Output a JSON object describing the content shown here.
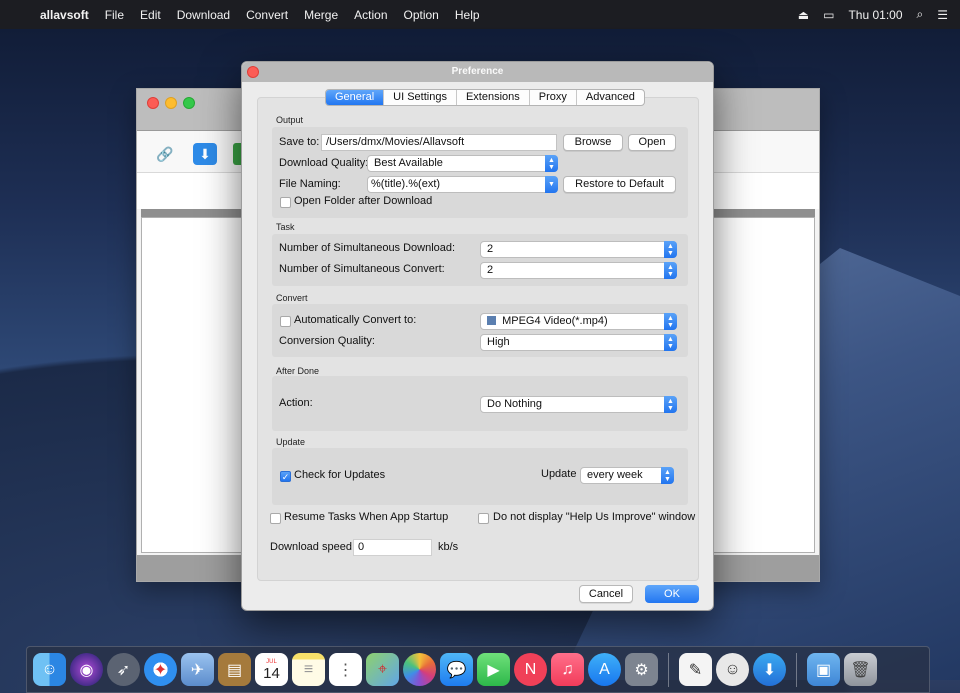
{
  "menubar": {
    "app_name": "allavsoft",
    "items": [
      "File",
      "Edit",
      "Download",
      "Convert",
      "Merge",
      "Action",
      "Option",
      "Help"
    ],
    "clock": "Thu 01:00"
  },
  "dialog": {
    "title": "Preference",
    "tabs": [
      {
        "label": "General",
        "active": true
      },
      {
        "label": "UI Settings",
        "active": false
      },
      {
        "label": "Extensions",
        "active": false
      },
      {
        "label": "Proxy",
        "active": false
      },
      {
        "label": "Advanced",
        "active": false
      }
    ],
    "output": {
      "section_label": "Output",
      "save_to_label": "Save to:",
      "save_to_value": "/Users/dmx/Movies/Allavsoft",
      "browse_label": "Browse",
      "open_label": "Open",
      "quality_label": "Download Quality:",
      "quality_value": "Best Available",
      "naming_label": "File Naming:",
      "naming_value": "%(title).%(ext)",
      "restore_label": "Restore to Default",
      "open_folder_label": "Open Folder after Download",
      "open_folder_checked": false
    },
    "task": {
      "section_label": "Task",
      "sim_download_label": "Number of Simultaneous Download:",
      "sim_download_value": "2",
      "sim_convert_label": "Number of Simultaneous Convert:",
      "sim_convert_value": "2"
    },
    "convert": {
      "section_label": "Convert",
      "auto_convert_label": "Automatically Convert to:",
      "auto_convert_checked": false,
      "format_value": "MPEG4 Video(*.mp4)",
      "quality_label": "Conversion Quality:",
      "quality_value": "High"
    },
    "after_done": {
      "section_label": "After Done",
      "action_label": "Action:",
      "action_value": "Do Nothing"
    },
    "update": {
      "section_label": "Update",
      "check_label": "Check for Updates",
      "check_checked": true,
      "update_label": "Update",
      "update_value": "every week"
    },
    "resume_label": "Resume Tasks When App Startup",
    "no_help_label": "Do not display \"Help Us Improve\" window",
    "speed_label": "Download speed:",
    "speed_value": "0",
    "speed_unit": "kb/s",
    "cancel_label": "Cancel",
    "ok_label": "OK"
  },
  "dock": {
    "calendar_month": "JUL",
    "calendar_day": "14"
  },
  "colors": {
    "accent": "#2276f1",
    "menubar_bg": "#1c1d22"
  }
}
